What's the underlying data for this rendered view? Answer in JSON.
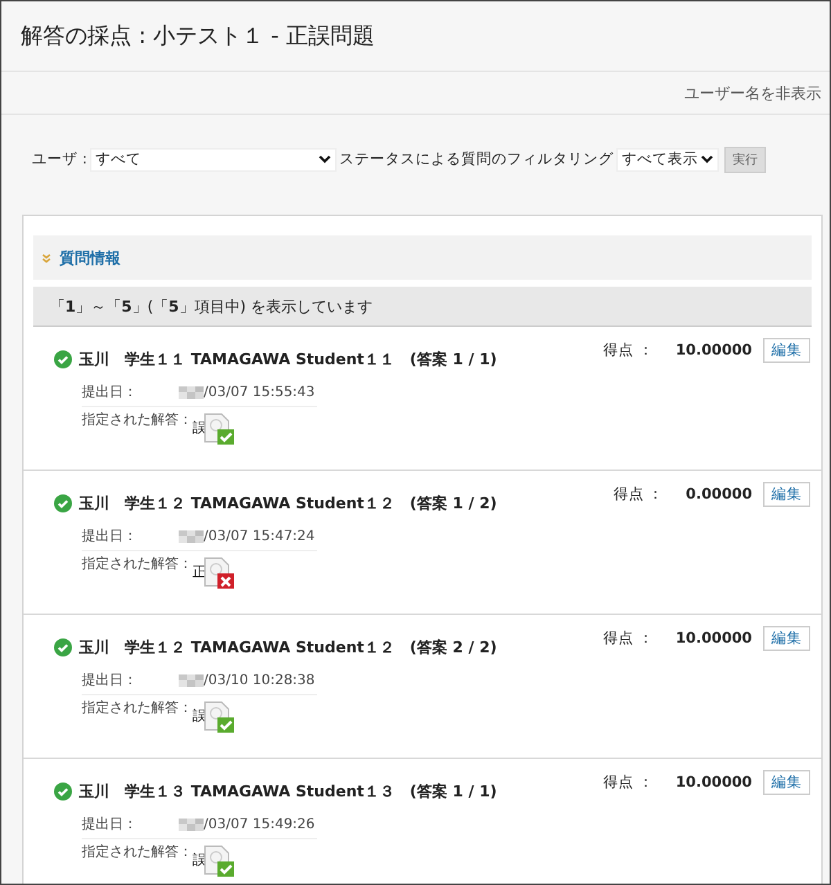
{
  "page_title": "解答の採点 : 小テスト１ - 正誤問題",
  "hide_names_link": "ユーザー名を非表示",
  "filter": {
    "user_label": "ユーザ :",
    "user_value": "すべて",
    "status_label": "ステータスによる質問のフィルタリング",
    "status_value": "すべて表示",
    "go_button": "実行"
  },
  "section": {
    "title": "質問情報",
    "expanded": false
  },
  "count_text": "「**1**」～「**5**」(「**5**」項目中) を表示しています",
  "attempts": [
    {
      "name": "玉川　学生１１ TAMAGAWA Student１１　(答案 1 / 1)",
      "score_label": "得点 ：",
      "score": "10.00000",
      "edit": "編集",
      "submitted_label": "提出日：",
      "submitted": "/03/07 15:55:43",
      "answer_label": "指定された解答：",
      "answer": "誤",
      "correct": true
    },
    {
      "name": "玉川　学生１２ TAMAGAWA Student１２　(答案 1 / 2)",
      "score_label": "得点 ：",
      "score": "0.00000",
      "edit": "編集",
      "submitted_label": "提出日：",
      "submitted": "/03/07 15:47:24",
      "answer_label": "指定された解答：",
      "answer": "正",
      "correct": false
    },
    {
      "name": "玉川　学生１２ TAMAGAWA Student１２　(答案 2 / 2)",
      "score_label": "得点 ：",
      "score": "10.00000",
      "edit": "編集",
      "submitted_label": "提出日：",
      "submitted": "/03/10 10:28:38",
      "answer_label": "指定された解答：",
      "answer": "誤",
      "correct": true
    },
    {
      "name": "玉川　学生１３ TAMAGAWA Student１３　(答案 1 / 1)",
      "score_label": "得点 ：",
      "score": "10.00000",
      "edit": "編集",
      "submitted_label": "提出日：",
      "submitted": "/03/07 15:49:26",
      "answer_label": "指定された解答：",
      "answer": "誤",
      "correct": true
    }
  ]
}
